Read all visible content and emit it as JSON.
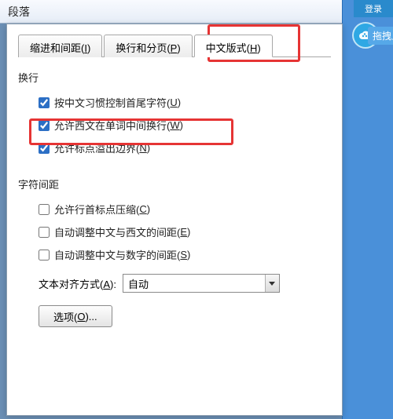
{
  "window": {
    "title": "段落",
    "login_btn": "登录"
  },
  "side": {
    "drag_label": "拖拽上传"
  },
  "tabs": {
    "t1_label": "缩进和间距(",
    "t1_key": "I",
    "t1_close": ")",
    "t2_label": "换行和分页(",
    "t2_key": "P",
    "t2_close": ")",
    "t3_label": "中文版式(",
    "t3_key": "H",
    "t3_close": ")"
  },
  "sections": {
    "line_break": "换行",
    "char_spacing": "字符间距"
  },
  "checks": {
    "c1_label": "按中文习惯控制首尾字符(",
    "c1_key": "U",
    "c1_close": ")",
    "c2_label": "允许西文在单词中间换行(",
    "c2_key": "W",
    "c2_close": ")",
    "c3_label": "允许标点溢出边界(",
    "c3_key": "N",
    "c3_close": ")",
    "c4_label": "允许行首标点压缩(",
    "c4_key": "C",
    "c4_close": ")",
    "c5_label": "自动调整中文与西文的间距(",
    "c5_key": "E",
    "c5_close": ")",
    "c6_label": "自动调整中文与数字的间距(",
    "c6_key": "S",
    "c6_close": ")"
  },
  "alignment": {
    "label": "文本对齐方式(",
    "key": "A",
    "close": "):",
    "value": "自动"
  },
  "options_btn": {
    "label": "选项(",
    "key": "O",
    "close": ")..."
  }
}
